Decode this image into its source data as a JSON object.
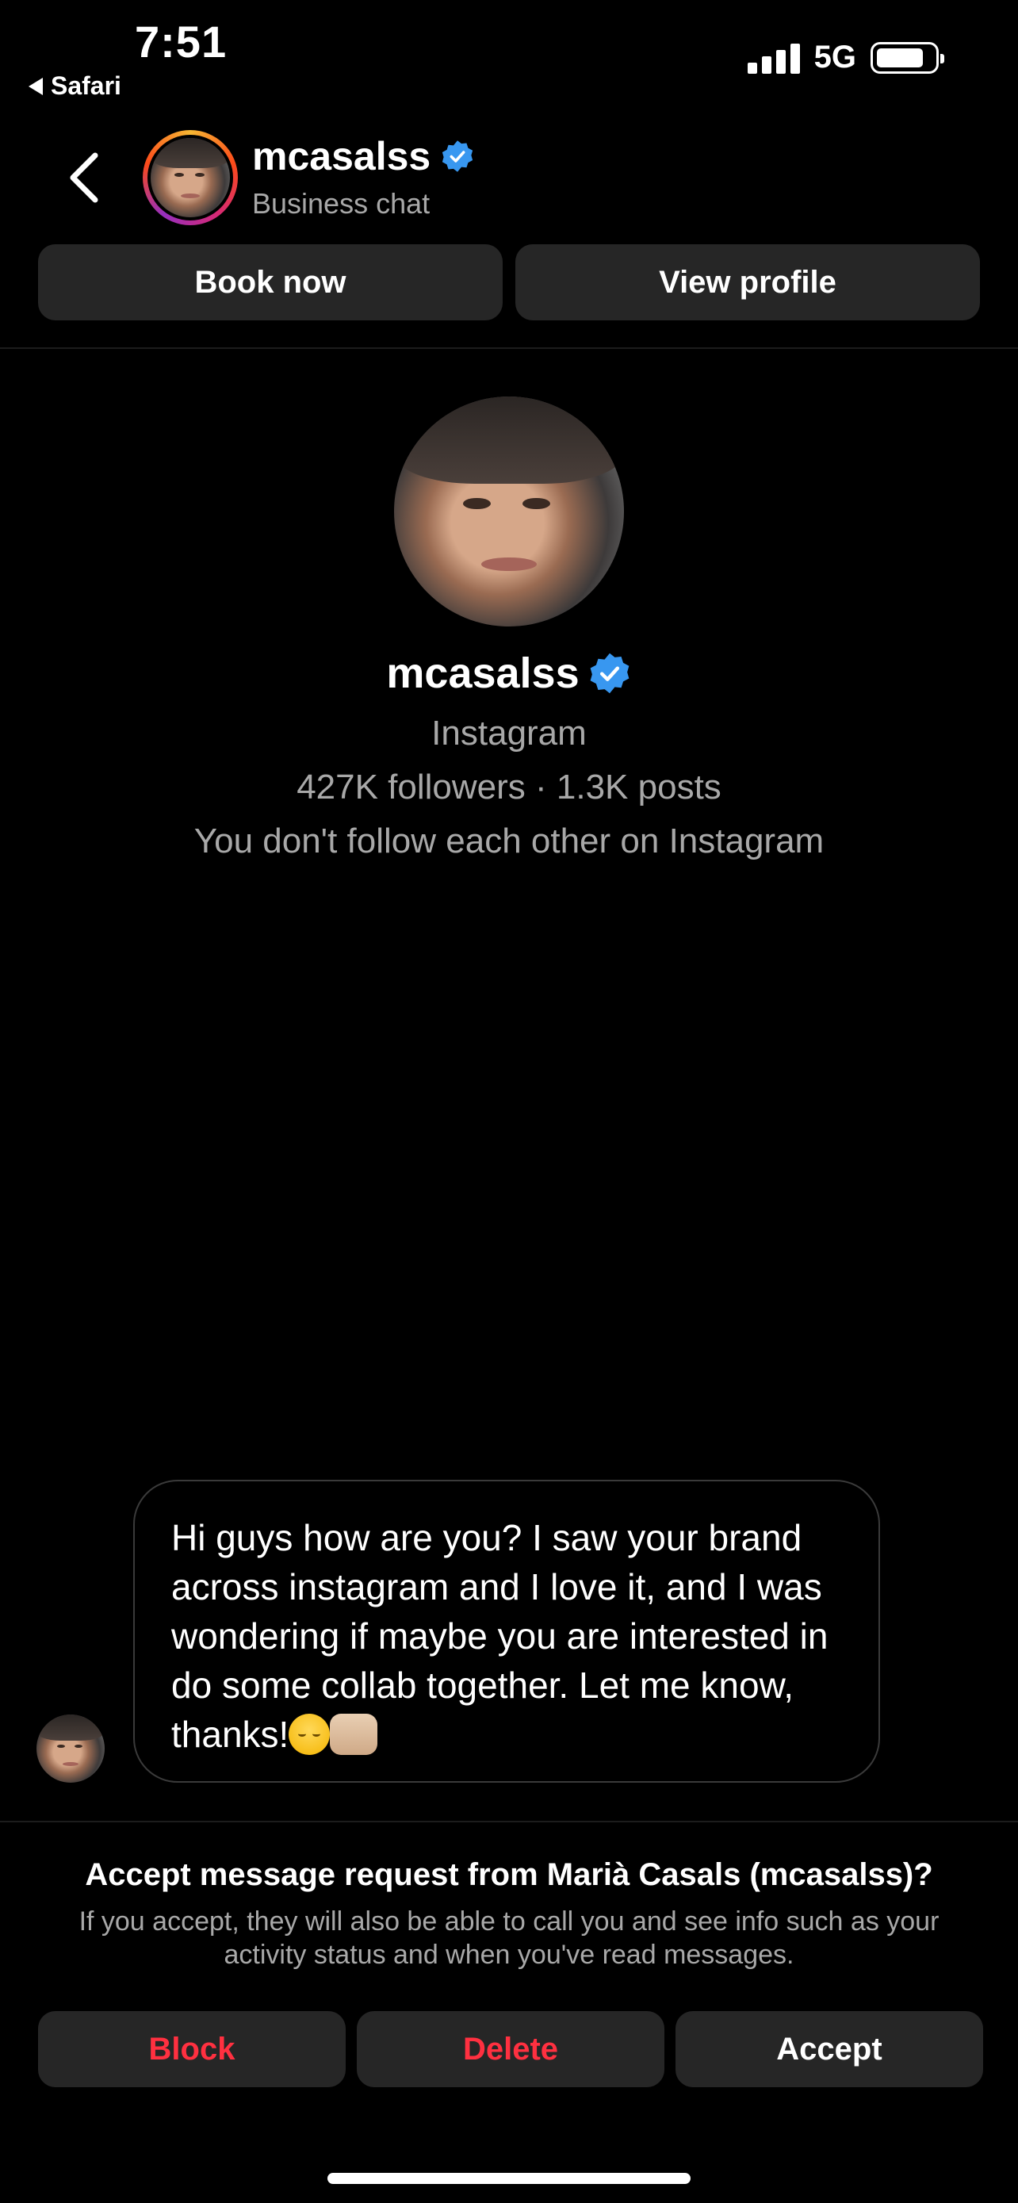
{
  "status_bar": {
    "time": "7:51",
    "back_app": "Safari",
    "network": "5G"
  },
  "header": {
    "name": "mcasalss",
    "subtitle": "Business chat",
    "verified_color": "#3897f0"
  },
  "actions_top": {
    "book": "Book now",
    "view_profile": "View profile"
  },
  "profile": {
    "name": "mcasalss",
    "platform": "Instagram",
    "stats": "427K followers · 1.3K posts",
    "relationship": "You don't follow each other on Instagram"
  },
  "message": {
    "text": "Hi guys how are you? I saw your brand across instagram and I love it, and I was wondering if maybe you are interested in do some collab together. Let me know, thanks!",
    "emojis": [
      "relieved-face",
      "raising-hands"
    ]
  },
  "request": {
    "title": "Accept message request from Marià Casals (mcasalss)?",
    "body": "If you accept, they will also be able to call you and see info such as your activity status and when you've read messages.",
    "block": "Block",
    "delete": "Delete",
    "accept": "Accept",
    "danger_color": "#ff3040"
  }
}
